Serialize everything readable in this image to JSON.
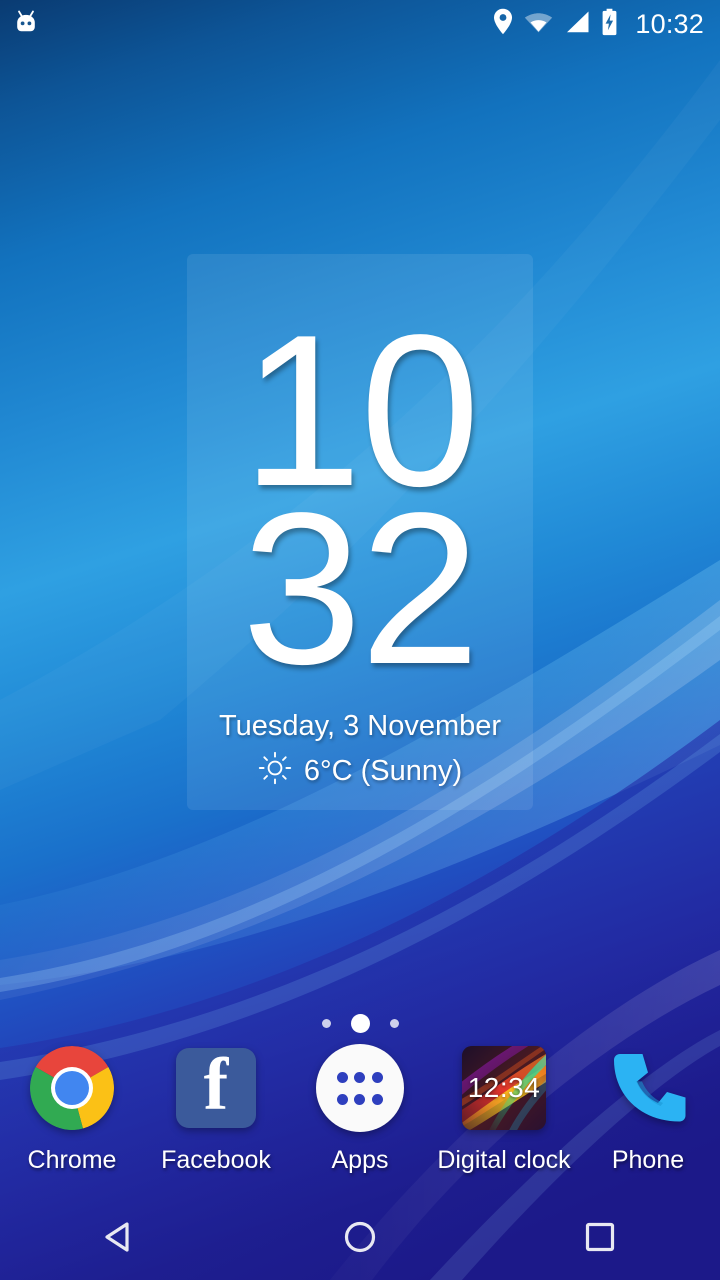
{
  "status_bar": {
    "notification_icon": "cyanogenmod-head-icon",
    "icons": [
      "location-pin-icon",
      "wifi-icon",
      "cellular-signal-icon",
      "battery-charging-icon"
    ],
    "clock": "10:32"
  },
  "clock_widget": {
    "hours": "10",
    "minutes": "32",
    "date": "Tuesday, 3 November",
    "weather_icon": "sun-icon",
    "weather": "6°C (Sunny)"
  },
  "page_indicator": {
    "total": 3,
    "active_index": 1
  },
  "dock": {
    "items": [
      {
        "label": "Chrome",
        "icon": "chrome-icon"
      },
      {
        "label": "Facebook",
        "icon": "facebook-icon"
      },
      {
        "label": "Apps",
        "icon": "apps-drawer-icon"
      },
      {
        "label": "Digital clock",
        "icon": "digital-clock-icon"
      },
      {
        "label": "Phone",
        "icon": "phone-icon"
      }
    ],
    "digital_clock_time": "12:34"
  },
  "nav_bar": {
    "back": "back-button",
    "home": "home-button",
    "recents": "recents-button"
  },
  "colors": {
    "wallpaper_top": "#0b3f78",
    "wallpaper_mid": "#2b9ae0",
    "wallpaper_bottom": "#1c1a86",
    "facebook_blue": "#3b5a9b",
    "apps_dot_blue": "#2e3fbe",
    "phone_blue": "#29b6f6",
    "accent_white": "#ffffff"
  }
}
